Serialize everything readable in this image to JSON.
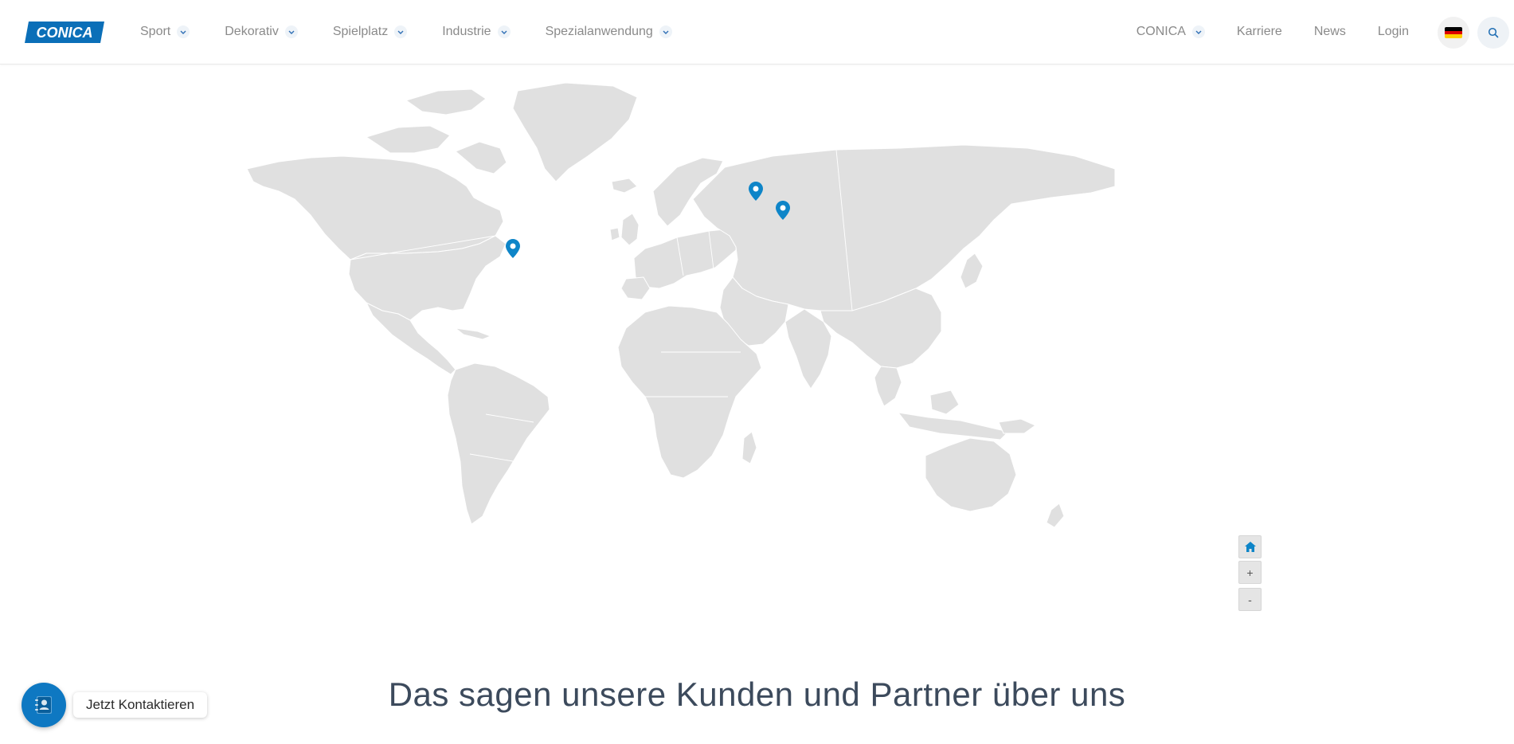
{
  "brand": {
    "logo_text": "CONICA",
    "color": "#0b6fb8"
  },
  "nav": {
    "left": [
      {
        "label": "Sport"
      },
      {
        "label": "Dekorativ"
      },
      {
        "label": "Spielplatz"
      },
      {
        "label": "Industrie"
      },
      {
        "label": "Spezialanwendung"
      }
    ],
    "right": [
      {
        "label": "CONICA"
      },
      {
        "label": "Karriere"
      },
      {
        "label": "News"
      },
      {
        "label": "Login"
      }
    ]
  },
  "language": {
    "icon": "flag-de-icon",
    "colors": [
      "#000000",
      "#dd0000",
      "#ffce00"
    ]
  },
  "search": {
    "icon": "search-icon"
  },
  "map": {
    "land_color": "#e0e0e0",
    "border_color": "#ffffff",
    "marker_color": "#0e85c8",
    "markers": [
      {
        "name": "marker-uk"
      },
      {
        "name": "marker-switzerland"
      },
      {
        "name": "marker-usa"
      }
    ],
    "controls": {
      "home_icon": "home-icon",
      "zoom_in": "+",
      "zoom_out": "-"
    }
  },
  "section": {
    "title": "Das sagen unsere Kunden und Partner über uns"
  },
  "contact": {
    "label": "Jetzt Kontaktieren",
    "icon": "contact-book-icon",
    "color": "#0e78c2"
  }
}
